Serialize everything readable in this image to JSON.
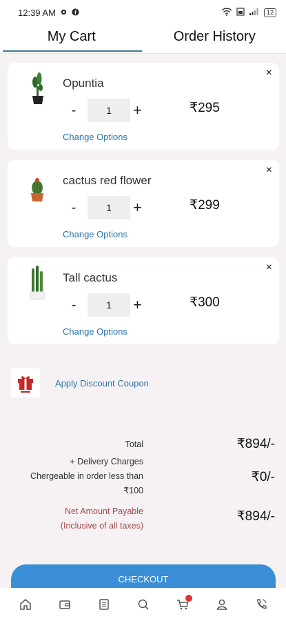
{
  "status_bar": {
    "time": "12:39 AM",
    "battery": "12"
  },
  "tabs": [
    {
      "label": "My Cart",
      "active": true
    },
    {
      "label": "Order History",
      "active": false
    }
  ],
  "cart": {
    "change_options_label": "Change Options",
    "minus": "-",
    "plus": "+",
    "close": "×",
    "items": [
      {
        "name": "Opuntia",
        "qty": "1",
        "price": "₹295",
        "icon": "opuntia-cactus"
      },
      {
        "name": "cactus red flower",
        "qty": "1",
        "price": "₹299",
        "icon": "red-flower-cactus"
      },
      {
        "name": "Tall cactus",
        "qty": "1",
        "price": "₹300",
        "icon": "tall-cactus"
      }
    ]
  },
  "coupon": {
    "label": "Apply Discount Coupon",
    "icon": "gift-icon"
  },
  "summary": {
    "total_label": "Total",
    "total_value": "₹894/-",
    "delivery_label_1": "+ Delivery Charges",
    "delivery_label_2": "Chergeable in order less than",
    "delivery_label_3": "₹100",
    "delivery_value": "₹0/-",
    "net_label_1": "Net Amount Payable",
    "net_label_2": "(Inclusive of all taxes)",
    "net_value": "₹894/-"
  },
  "checkout_label": "CHECKOUT",
  "bottom_nav": {
    "icons": [
      "home-icon",
      "wallet-icon",
      "orders-icon",
      "search-icon",
      "cart-icon",
      "user-icon",
      "phone-icon"
    ],
    "cart_has_badge": true
  },
  "colors": {
    "accent_link": "#2a73a7",
    "checkout_bg": "#3a8ed3",
    "net_label": "#a44a4a",
    "tab_underline": "#3b7a8f"
  }
}
